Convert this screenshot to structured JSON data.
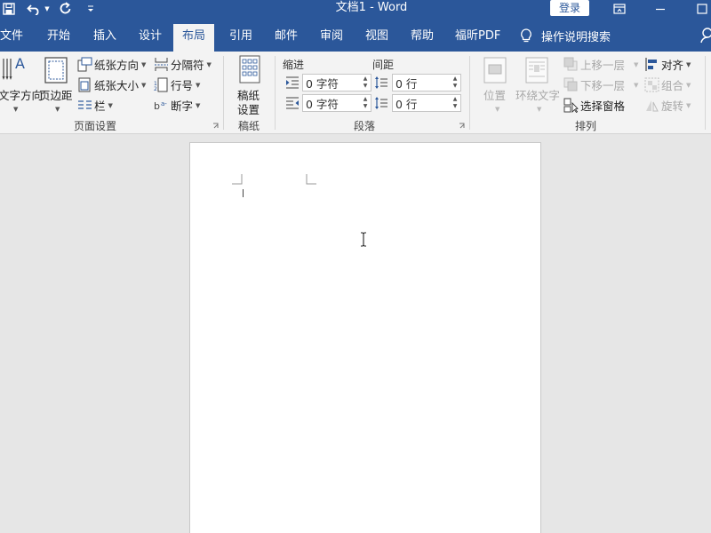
{
  "window": {
    "doc_title": "文档1  -  Word",
    "signin_label": "登录",
    "quick_access": [
      "save-icon",
      "undo-icon",
      "redo-icon",
      "customize-icon"
    ],
    "window_controls": [
      "ribbon-display-icon",
      "minimize-icon",
      "maximize-icon"
    ]
  },
  "tabs": [
    {
      "label": "文件"
    },
    {
      "label": "开始"
    },
    {
      "label": "插入"
    },
    {
      "label": "设计"
    },
    {
      "label": "布局",
      "active": true
    },
    {
      "label": "引用"
    },
    {
      "label": "邮件"
    },
    {
      "label": "审阅"
    },
    {
      "label": "视图"
    },
    {
      "label": "帮助"
    },
    {
      "label": "福昕PDF"
    }
  ],
  "tell_me": {
    "label": "操作说明搜索",
    "icon": "lightbulb-icon"
  },
  "ribbon": {
    "page_setup": {
      "text_direction_label": "文字方向",
      "margins_label": "页边距",
      "orientation_label": "纸张方向",
      "size_label": "纸张大小",
      "columns_label": "栏",
      "breaks_label": "分隔符",
      "line_numbers_label": "行号",
      "hyphenation_label": "断字",
      "group_label": "页面设置"
    },
    "manuscript": {
      "label_line1": "稿纸",
      "label_line2": "设置",
      "group_label": "稿纸"
    },
    "paragraph": {
      "indent_label": "缩进",
      "spacing_label": "间距",
      "indent_left_value": "0 字符",
      "indent_right_value": "0 字符",
      "spacing_before_value": "0 行",
      "spacing_after_value": "0 行",
      "group_label": "段落"
    },
    "arrange": {
      "position_label": "位置",
      "wrap_text_label": "环绕文字",
      "bring_forward_label": "上移一层",
      "send_backward_label": "下移一层",
      "selection_pane_label": "选择窗格",
      "align_label": "对齐",
      "group_obj_label": "组合",
      "rotate_label": "旋转",
      "group_label": "排列"
    }
  },
  "colors": {
    "title_bar": "#2b579a",
    "ribbon_bg": "#f3f3f3",
    "canvas_bg": "#e6e6e6",
    "page_bg": "#ffffff"
  }
}
